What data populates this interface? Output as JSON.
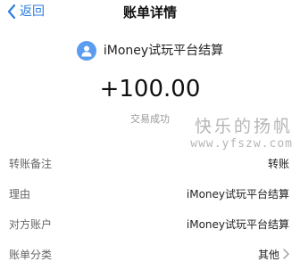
{
  "nav": {
    "back_label": "返回",
    "title": "账单详情"
  },
  "merchant": {
    "name": "iMoney试玩平台结算",
    "icon": "user-icon"
  },
  "amount": "+100.00",
  "status": "交易成功",
  "watermark": {
    "line1": "快乐的扬帆",
    "line2": "www.yfszw.com"
  },
  "details": [
    {
      "label": "转账备注",
      "value": "转账"
    },
    {
      "label": "理由",
      "value": "iMoney试玩平台结算"
    },
    {
      "label": "对方账户",
      "value": "iMoney试玩平台结算"
    },
    {
      "label": "账单分类",
      "value": "其他"
    }
  ],
  "colors": {
    "accent": "#2b7fe0",
    "avatar": "#5b9cf0"
  }
}
